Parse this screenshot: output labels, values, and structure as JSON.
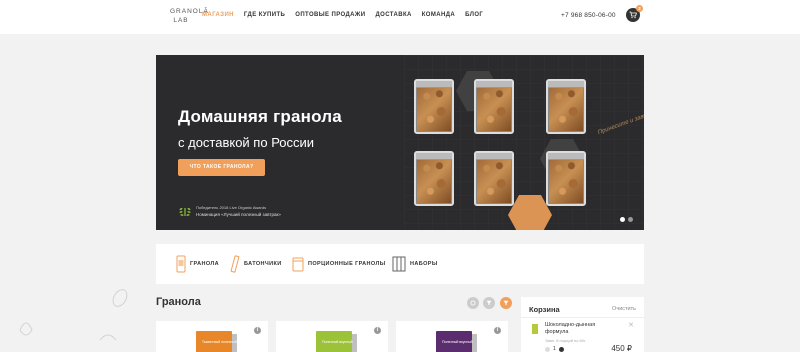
{
  "header": {
    "logo_line1": "GRANOLĀ",
    "logo_line2": "LAB",
    "nav": [
      {
        "label": "МАГАЗИН",
        "active": true
      },
      {
        "label": "ГДЕ КУПИТЬ",
        "active": false
      },
      {
        "label": "ОПТОВЫЕ ПРОДАЖИ",
        "active": false
      },
      {
        "label": "ДОСТАВКА",
        "active": false
      },
      {
        "label": "КОМАНДА",
        "active": false
      },
      {
        "label": "БЛОГ",
        "active": false
      }
    ],
    "phone": "+7 968 850-06-00",
    "cart_icon": "cart-icon",
    "cart_count": "2"
  },
  "hero": {
    "title": "Домашняя гранола",
    "subtitle": "с доставкой по России",
    "button_label": "ЧТО ТАКОЕ ГРАНОЛА?",
    "award_line1": "Победитель 2018 Live Organic Awards",
    "award_line2": "Номинация «Лучший полезный завтрак»",
    "handwriting": "Принесите и завтракайте",
    "slides_total": 2,
    "slide_active": 1
  },
  "categories": [
    {
      "label": "ГРАНОЛА",
      "icon": "granola-pack-icon"
    },
    {
      "label": "БАТОНЧИКИ",
      "icon": "bar-icon"
    },
    {
      "label": "ПОРЦИОННЫЕ ГРАНОЛЫ",
      "icon": "portion-pack-icon"
    },
    {
      "label": "НАБОРЫ",
      "icon": "gift-box-icon"
    }
  ],
  "section": {
    "title": "Гранола",
    "filter_icons": [
      "refresh-icon",
      "filter-icon",
      "sort-icon"
    ]
  },
  "products": [
    {
      "box_label": "Тыквенный полезный",
      "color": "#e8872a"
    },
    {
      "box_label": "Полезный вкусный",
      "color": "#9cc23a"
    },
    {
      "box_label": "Полезный вкусный",
      "color": "#5b2d6e"
    }
  ],
  "cart": {
    "title": "Корзина",
    "clear_label": "Очистить",
    "item_name_line1": "Шоколадно-дынная",
    "item_name_line2": "формула",
    "item_desc": "Эквл. 8 порций по 60г",
    "item_qty": "1",
    "item_price": "450 ₽"
  },
  "colors": {
    "accent": "#f0a05a",
    "hero_bg": "#2b2b2d",
    "page_bg": "#f2f2f2"
  }
}
